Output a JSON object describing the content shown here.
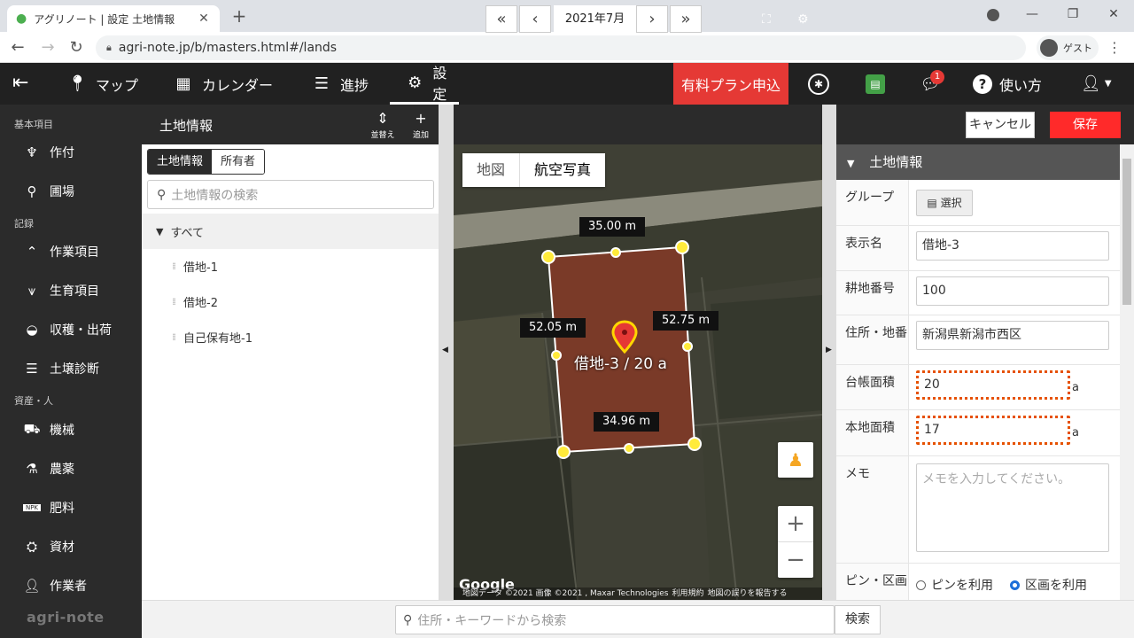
{
  "browser": {
    "tab_title": "アグリノート | 設定 土地情報",
    "url": "agri-note.jp/b/masters.html#/lands",
    "profile": "ゲスト"
  },
  "header": {
    "nav": [
      {
        "label": "マップ",
        "icon": "map-pin-icon"
      },
      {
        "label": "カレンダー",
        "icon": "calendar-icon"
      },
      {
        "label": "進捗",
        "icon": "checklist-icon"
      },
      {
        "label": "設定",
        "icon": "gear-icon"
      }
    ],
    "premium_label": "有料プラン申込",
    "notification_count": "1",
    "help_label": "使い方"
  },
  "sidebar": {
    "sections": [
      {
        "title": "基本項目",
        "items": [
          "作付",
          "圃場"
        ]
      },
      {
        "title": "記録",
        "items": [
          "作業項目",
          "生育項目",
          "収穫・出荷",
          "土壌診断"
        ]
      },
      {
        "title": "資産・人",
        "items": [
          "機械",
          "農薬",
          "肥料",
          "資材",
          "作業者"
        ]
      }
    ],
    "logo": "agri-note"
  },
  "list_panel": {
    "title": "土地情報",
    "sort_label": "並替え",
    "add_label": "追加",
    "tabs": [
      "土地情報",
      "所有者"
    ],
    "search_placeholder": "土地情報の検索",
    "tree_root": "すべて",
    "items": [
      "借地-1",
      "借地-2",
      "自己保有地-1"
    ]
  },
  "map": {
    "month": "2021年7月",
    "map_types": [
      "地図",
      "航空写真"
    ],
    "dimensions": [
      "35.00 m",
      "52.05 m",
      "52.75 m",
      "34.96 m"
    ],
    "field_label": "借地-3 / 20 a",
    "attribution": [
      "地図データ ©2021 画像 ©2021 , Maxar Technologies",
      "利用規約",
      "地図の誤りを報告する"
    ],
    "brand": "Google"
  },
  "form": {
    "cancel_label": "キャンセル",
    "save_label": "保存",
    "section_title": "土地情報",
    "group_label": "グループ",
    "group_button": "選択",
    "display_name_label": "表示名",
    "display_name_value": "借地-3",
    "parcel_no_label": "耕地番号",
    "parcel_no_value": "100",
    "address_label": "住所・地番",
    "address_value": "新潟県新潟市西区",
    "ledger_area_label": "台帳面積",
    "ledger_area_value": "20",
    "actual_area_label": "本地面積",
    "actual_area_value": "17",
    "unit": "a",
    "memo_label": "メモ",
    "memo_placeholder": "メモを入力してください。",
    "pin_area_label": "ピン・区画",
    "radio_pin": "ピンを利用",
    "radio_area": "区画を利用"
  },
  "bottom_search": {
    "placeholder": "住所・キーワードから検索",
    "button": "検索"
  },
  "colors": {
    "header_bg": "#212121",
    "premium": "#e53935",
    "save": "#ff2a2a",
    "field_fill": "#7a3a28",
    "highlight_border": "#e65100"
  }
}
